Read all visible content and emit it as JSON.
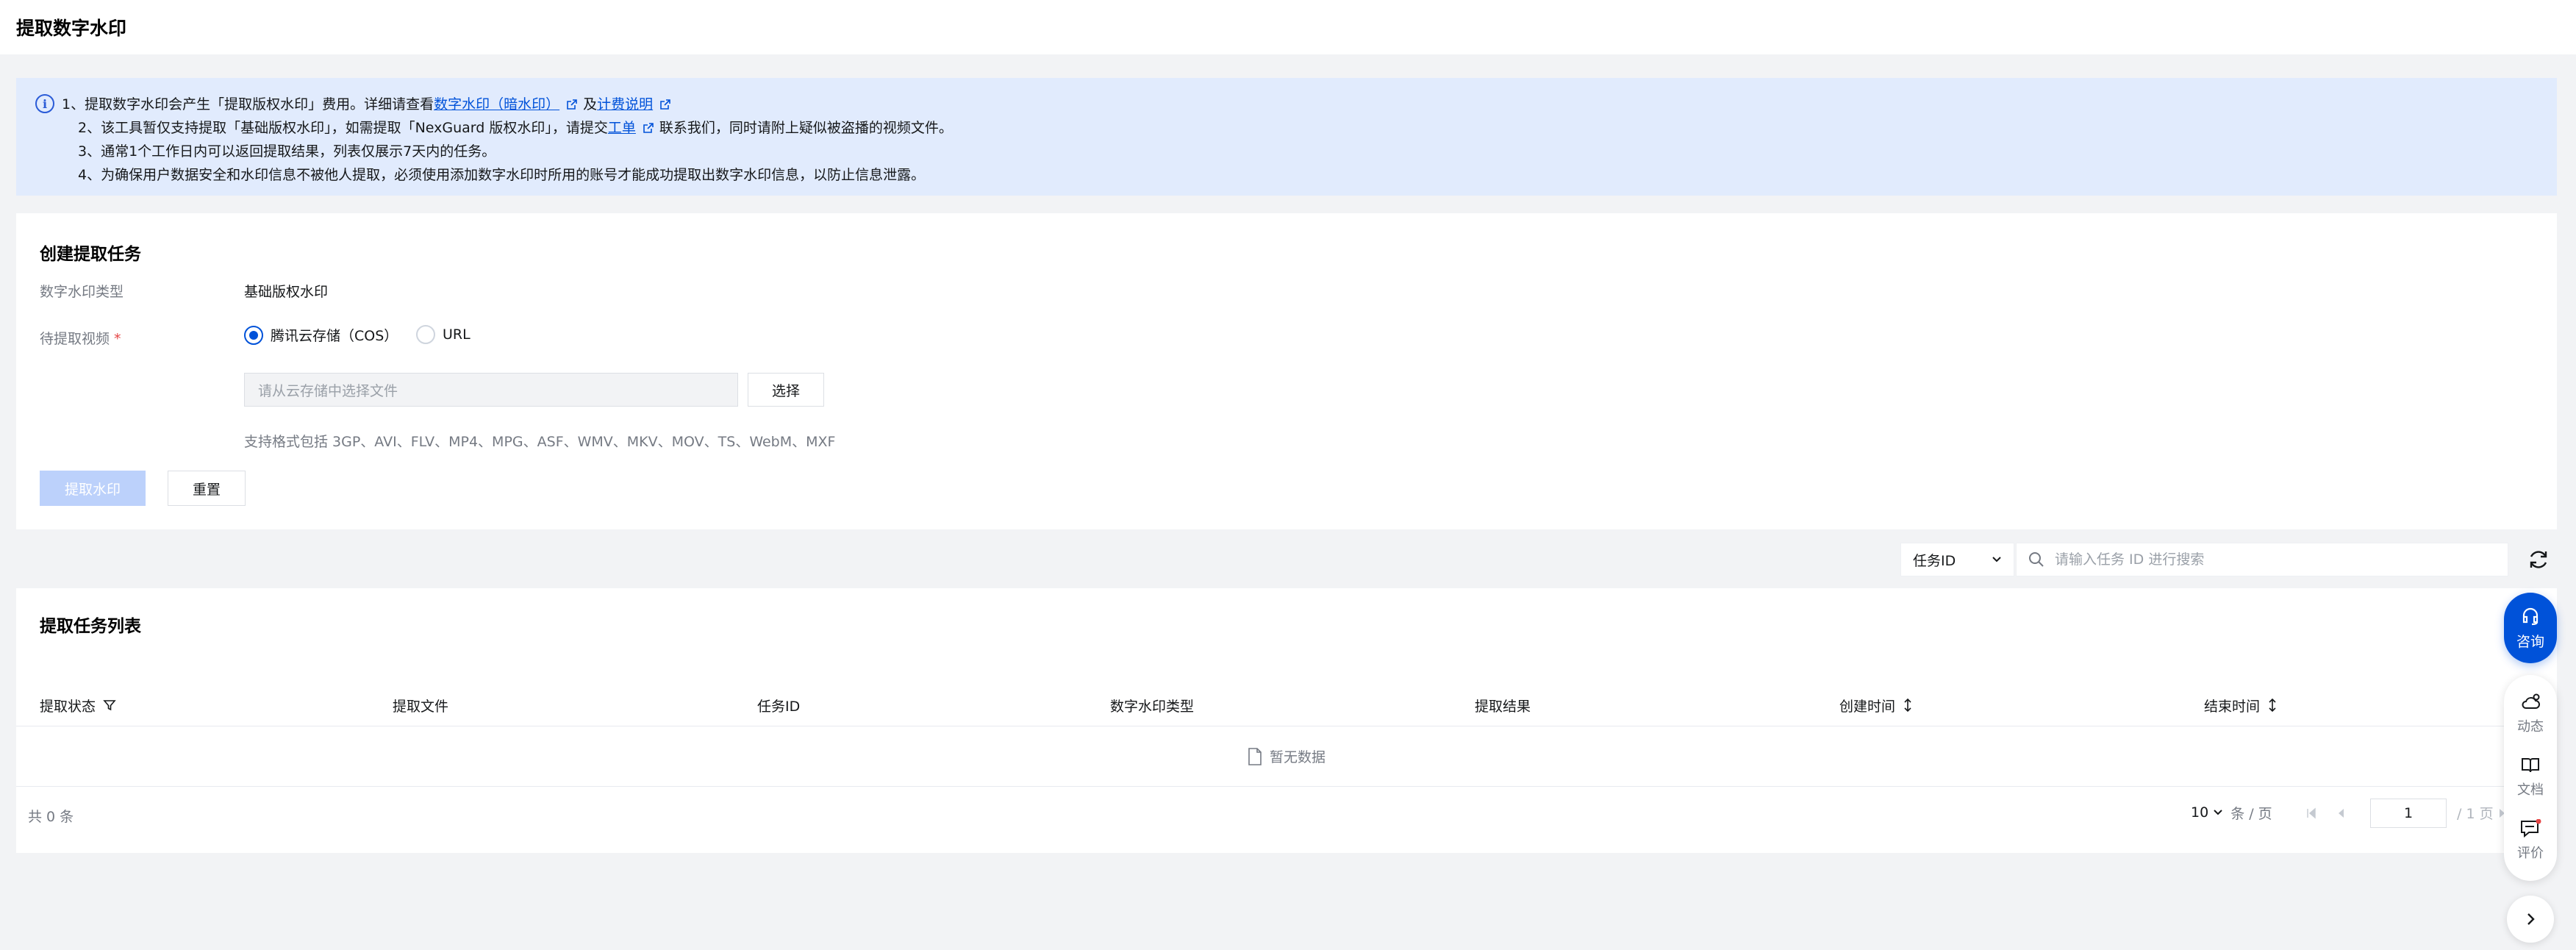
{
  "header": {
    "title": "提取数字水印"
  },
  "notice": {
    "line1_prefix": "1、提取数字水印会产生「提取版权水印」费用。详细请查看",
    "line1_link1": "数字水印（暗水印）",
    "line1_mid": "及",
    "line1_link2": "计费说明",
    "line2_prefix": "2、该工具暂仅支持提取「基础版权水印」，如需提取「NexGuard 版权水印」，请提交",
    "line2_link": "工单",
    "line2_suffix": "联系我们，同时请附上疑似被盗播的视频文件。",
    "line3": "3、通常1个工作日内可以返回提取结果，列表仅展示7天内的任务。",
    "line4": "4、为确保用户数据安全和水印信息不被他人提取，必须使用添加数字水印时所用的账号才能成功提取出数字水印信息，以防止信息泄露。"
  },
  "create_task": {
    "title": "创建提取任务",
    "type_label": "数字水印类型",
    "type_value": "基础版权水印",
    "video_label": "待提取视频",
    "required_mark": "*",
    "radio_cos": "腾讯云存储（COS）",
    "radio_url": "URL",
    "file_placeholder": "请从云存储中选择文件",
    "choose_button": "选择",
    "format_hint": "支持格式包括 3GP、AVI、FLV、MP4、MPG、ASF、WMV、MKV、MOV、TS、WebM、MXF",
    "extract_button": "提取水印",
    "reset_button": "重置"
  },
  "search": {
    "select_value": "任务ID",
    "placeholder": "请输入任务 ID 进行搜索"
  },
  "task_list": {
    "title": "提取任务列表",
    "columns": [
      "提取状态",
      "提取文件",
      "任务ID",
      "数字水印类型",
      "提取结果",
      "创建时间",
      "结束时间"
    ],
    "empty_text": "暂无数据",
    "total": "共 0 条",
    "page_size": "10",
    "page_size_unit": "条 / 页",
    "current_page": "1",
    "total_pages": "/ 1 页"
  },
  "float_bar": {
    "consult": "咨询",
    "news": "动态",
    "docs": "文档",
    "review": "评价"
  },
  "colors": {
    "primary": "#0052d9",
    "notice_bg": "#e1ebfd",
    "disabled_primary": "#bcd1fb"
  }
}
